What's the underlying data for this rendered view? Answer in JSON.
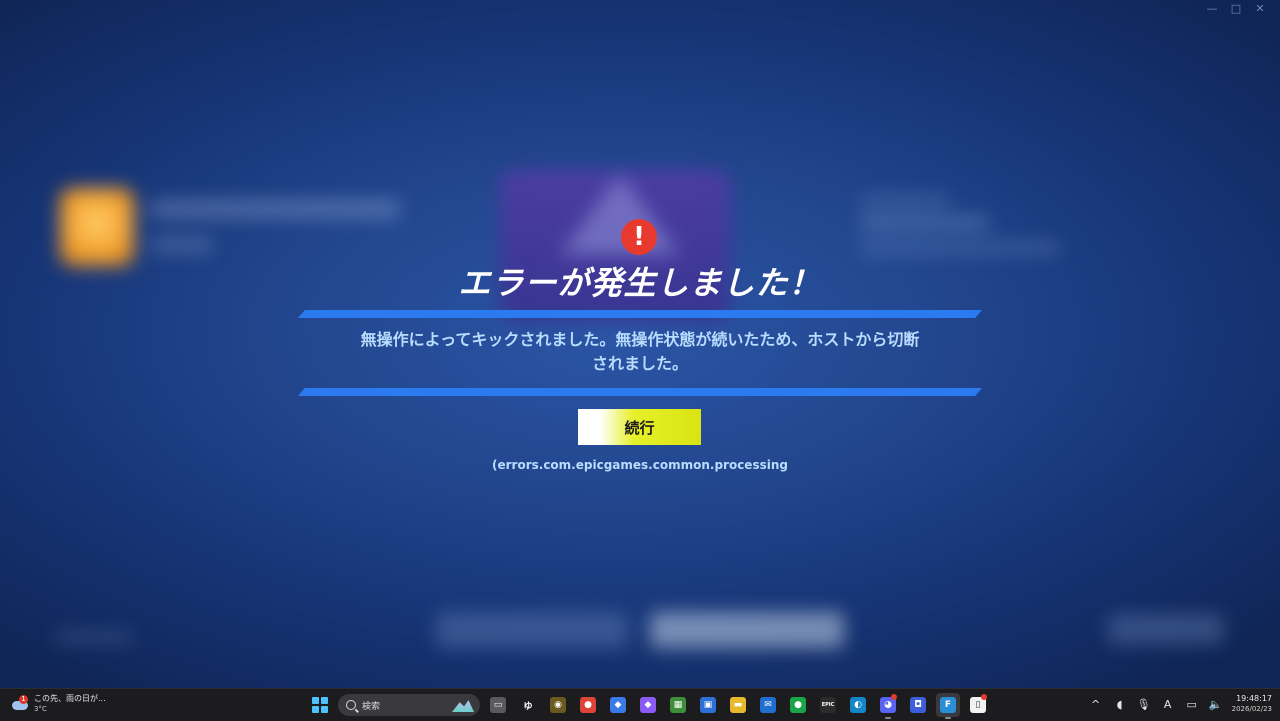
{
  "window": {
    "controls": [
      "—",
      "□",
      "✕"
    ]
  },
  "dialog": {
    "title": "エラーが発生しました！",
    "message_line1": "無操作によってキックされました。無操作状態が続いたため、ホストから切断",
    "message_line2": "されました。",
    "continue_label": "続行",
    "error_code": "(errors.com.epicgames.common.processing",
    "icon_glyph": "!"
  },
  "taskbar": {
    "weather": {
      "badge": "1",
      "line1": "この先、雨の日が...",
      "line2": "3°C"
    },
    "search_label": "検索",
    "apps": [
      {
        "name": "task-view-icon",
        "glyph": "▭",
        "bg": "#5a5a60"
      },
      {
        "name": "ime-app-icon",
        "glyph": "ゆ",
        "bg": "#1c1c1f"
      },
      {
        "name": "circle-app-icon",
        "glyph": "◉",
        "bg": "#6b5a1f"
      },
      {
        "name": "chrome-icon",
        "glyph": "●",
        "bg": "#db4437"
      },
      {
        "name": "copilot-m365-icon",
        "glyph": "◆",
        "bg": "#3b7be8"
      },
      {
        "name": "copilot-icon",
        "glyph": "◆",
        "bg": "#8a5cf5"
      },
      {
        "name": "minecraft-icon",
        "glyph": "▦",
        "bg": "#3f8f3a"
      },
      {
        "name": "store-icon",
        "glyph": "▣",
        "bg": "#2d6fd6"
      },
      {
        "name": "file-explorer-icon",
        "glyph": "▬",
        "bg": "#e8b92d"
      },
      {
        "name": "outlook-icon",
        "glyph": "✉",
        "bg": "#1f6fd0"
      },
      {
        "name": "xbox-icon",
        "glyph": "●",
        "bg": "#1aa548"
      },
      {
        "name": "epic-games-icon",
        "glyph": "EPIC",
        "bg": "#2b2b2b"
      },
      {
        "name": "edge-icon",
        "glyph": "◐",
        "bg": "#1587c9"
      },
      {
        "name": "discord-icon",
        "glyph": "◕",
        "bg": "#5865f2"
      },
      {
        "name": "app-blue-icon",
        "glyph": "◘",
        "bg": "#3d5ed9"
      },
      {
        "name": "fortnite-icon",
        "glyph": "F",
        "bg": "#2a8ed6"
      },
      {
        "name": "document-icon",
        "glyph": "▯",
        "bg": "#f2f2f2"
      }
    ],
    "tray": {
      "chevron": "^",
      "ime": "A",
      "time": "19:48:17",
      "date": "2026/02/23"
    }
  }
}
